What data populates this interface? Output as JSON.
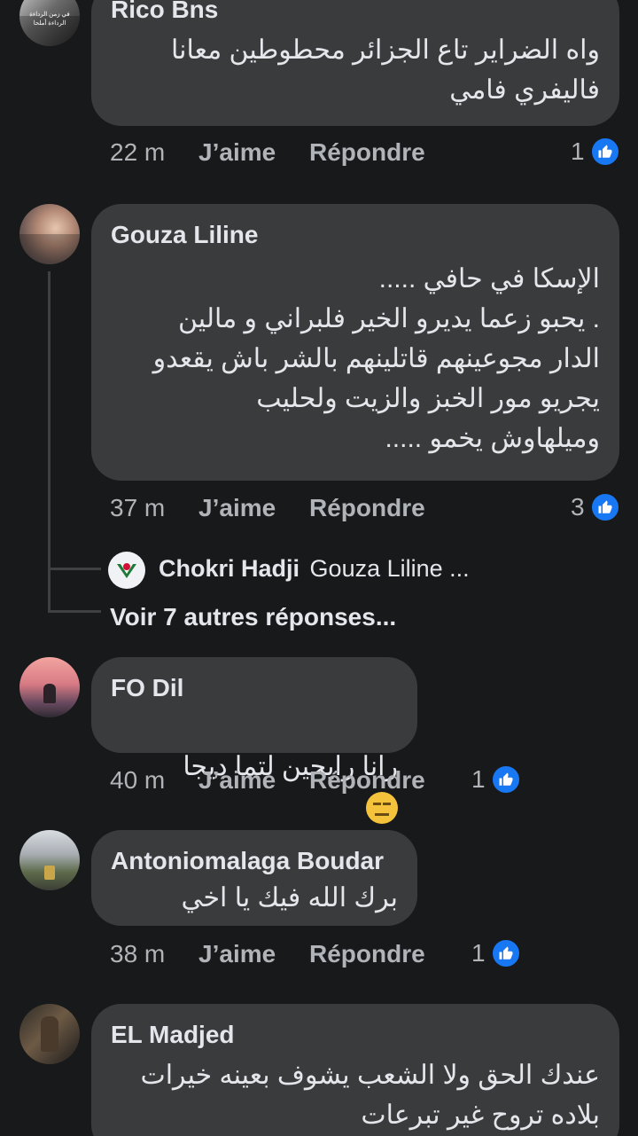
{
  "comments": [
    {
      "author": "Rico Bns",
      "text": "واه الضراير تاع الجزائر محطوطين معانا\nفاليفري فامي",
      "time": "22 m",
      "like_label": "J’aime",
      "reply_label": "Répondre",
      "reactions": "1",
      "avatar_text": "في زمن الرداءة\nالرداءة أملحا"
    },
    {
      "author": "Gouza Liline",
      "text": "الإسكا في حافي .....\n. يحبو زعما يديرو الخير فلبراني و مالين\nالدار مجوعينهم قاتلينهم بالشر باش يقعدو\nيجريو مور الخبز والزيت ولحليب\nوميلهاوش يخمو .....",
      "time": "37 m",
      "like_label": "J’aime",
      "reply_label": "Répondre",
      "reactions": "3"
    },
    {
      "author": "FO Dil",
      "text": "رانا رايحين لتما ديجا",
      "time": "40 m",
      "like_label": "J’aime",
      "reply_label": "Répondre",
      "reactions": "1"
    },
    {
      "author": "Antoniomalaga Boudar",
      "text": "برك الله فيك يا اخي",
      "time": "38 m",
      "like_label": "J’aime",
      "reply_label": "Répondre",
      "reactions": "1"
    },
    {
      "author": "EL Madjed",
      "text": "عندك الحق ولا الشعب يشوف بعينه خيرات\nبلاده تروح غير تبرعات"
    }
  ],
  "reply_preview": {
    "author": "Chokri Hadji",
    "snippet": "Gouza Liline ..."
  },
  "more_replies": "Voir 7 autres réponses...",
  "colors": {
    "background": "#18191a",
    "bubble": "#3a3b3c",
    "like_blue": "#1877f2"
  }
}
